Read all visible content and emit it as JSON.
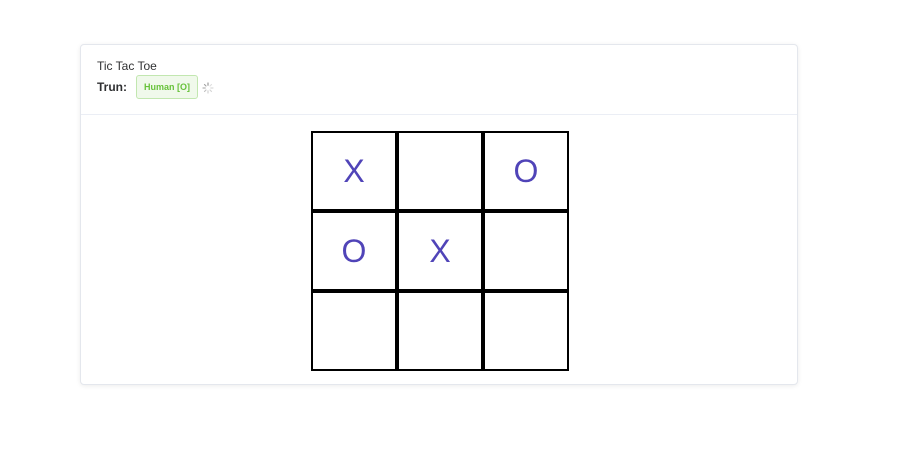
{
  "game": {
    "title": "Tic Tac Toe",
    "turn_label": "Trun:",
    "current_player": "Human [O]",
    "board": [
      "X",
      "",
      "O",
      "O",
      "X",
      "",
      "",
      "",
      ""
    ]
  },
  "colors": {
    "mark": "#5044b8",
    "tag_text": "#67c23a",
    "tag_bg": "#f0f9eb",
    "grid_line": "#000000"
  },
  "icons": {
    "turn_indicator": "loading-spinner-icon"
  }
}
